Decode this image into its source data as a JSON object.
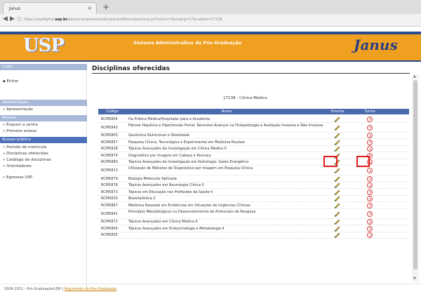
{
  "browser": {
    "tab_title": "Janus",
    "close_glyph": "×",
    "newtab_glyph": "+",
    "url_prefix": "https://uspdigital.",
    "url_domain": "usp.br",
    "url_rest": "/janus/componente/disciplinasOferecidasInicial.jsf?action=3&codcg=17&codare=17138"
  },
  "banner": {
    "logo": "USP",
    "system_title": "Sistema Administrativo da Pós-Graduação",
    "brand": "Janus"
  },
  "sidebar": {
    "login_header": "Login",
    "login_item": "Entrar",
    "apresentacao_header": "Apresentação",
    "apresentacao_item": "Apresentação",
    "acesso_header": "Acesso",
    "acesso_items": [
      "Esqueci a senha",
      "Primeiro acesso"
    ],
    "publico_header": "Acesso público",
    "publico_items": [
      "Período de matrícula",
      "Disciplinas oferecidas",
      "Catálogo de disciplinas",
      "Orientadores"
    ],
    "egressos": "Egressos USP"
  },
  "main": {
    "title": "Disciplinas oferecidas",
    "section": "17138 - Clínica Médica",
    "columns": {
      "code": "Código",
      "name": "Nome",
      "ementa": "Ementa",
      "turma": "Turma"
    },
    "rows": [
      {
        "code": "RCM5804",
        "name": "Da Prática Médica/Hospitalar para a Academia"
      },
      {
        "code": "RCM5843",
        "name": "Fibrose Hepática e Hipertensão Portal: Recentes Avanços na Fisiopatologia e Avaliação Invasiva e Não Invasiva"
      },
      {
        "code": "RCM5805",
        "name": "Genômica Nutricional e Obesidade"
      },
      {
        "code": "RCM5857",
        "name": "Pesquisa Clínica, Tecnológica e Experimental em Medicina Nuclear"
      },
      {
        "code": "RCM5828",
        "name": "Tópicos Avançados de Investigação em Clínica Médica II"
      },
      {
        "code": "RCM5874",
        "name": "Diagnóstico por Imagem em Cabeça e Pescoço"
      },
      {
        "code": "RCM5880",
        "name": "Tópicos Avançados de Investigação em Nutrologia: Gasto Energético"
      },
      {
        "code": "RCM5813",
        "name": "Utilização de Métodos de Diagnóstico por Imagem em Pesquisa Clínica"
      },
      {
        "code": "RCM5879",
        "name": "Biologia Molecular Aplicada"
      },
      {
        "code": "RCM5878",
        "name": "Tópicos Avançados em Neurologia Clínica II"
      },
      {
        "code": "RCM5873",
        "name": "Tópicos em Educação nas Profissões da Saúde II"
      },
      {
        "code": "RCM5830",
        "name": "Bioestatística II"
      },
      {
        "code": "RCM5867",
        "name": "Medicina Baseada em Evidências em Situações de Urgências Clínicas"
      },
      {
        "code": "RCM5841",
        "name": "Princípios Metodológicos no Desenvolvimento de Protocolos de Pesquisa"
      },
      {
        "code": "RCM5872",
        "name": "Tópicos Avançados em Clínica Médica II"
      },
      {
        "code": "RCM5856",
        "name": "Tópicos Avançados em Endocrinologia e Metabologia II"
      },
      {
        "code": "RCM5855",
        "name": ""
      }
    ]
  },
  "footer": {
    "text": "2004-2011 - Pró-Graduação/USP | ",
    "link": "Regimento da Pós-Graduação"
  }
}
